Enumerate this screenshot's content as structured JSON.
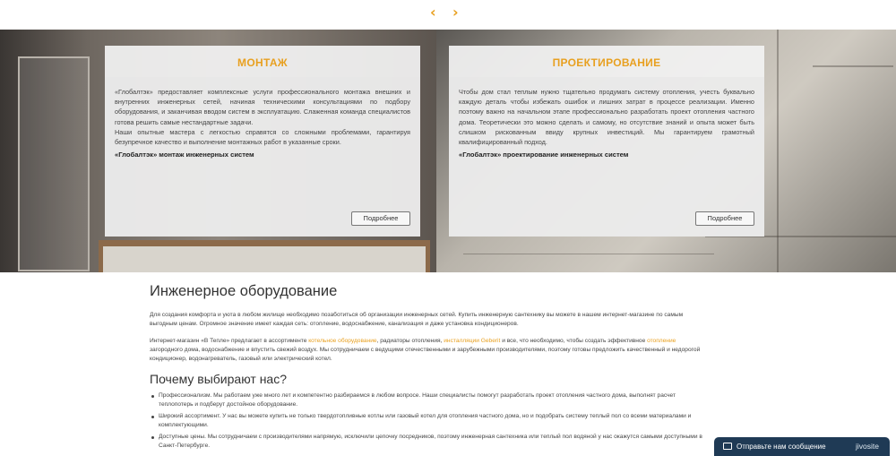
{
  "carousel": {
    "prev_icon": "‹",
    "next_icon": "›"
  },
  "cards": [
    {
      "title": "МОНТАЖ",
      "paragraphs": [
        "«Глобалтэк» предоставляет комплексные услуги профессионального монтажа внешних и внутренних инженерных сетей, начиная техническими консультациями по подбору оборудования, и заканчивая вводом систем в эксплуатацию. Слаженная команда специалистов готова решить самые нестандартные задачи.",
        "Наши опытные мастера с легкостью справятся со сложными проблемами, гарантируя безупречное качество и выполнение монтажных работ в указанные сроки."
      ],
      "bold": "«Глобалтэк» монтаж инженерных систем",
      "button": "Подробнее"
    },
    {
      "title": "ПРОЕКТИРОВАНИЕ",
      "paragraphs": [
        "Чтобы дом стал теплым нужно тщательно продумать систему отопления, учесть буквально каждую деталь чтобы избежать ошибок и лишних затрат в процессе реализации. Именно поэтому важно на начальном этапе профессионально разработать проект отопления частного дома. Теоретически это можно сделать и самому, но отсутствие знаний и опыта может быть слишком рискованным ввиду крупных инвестиций. Мы гарантируем грамотный квалифицированный подход."
      ],
      "bold": "«Глобалтэк» проектирование инженерных систем",
      "button": "Подробнее"
    }
  ],
  "article": {
    "title": "Инженерное оборудование",
    "intro": "Для создания комфорта и уюта в любом жилище необходимо позаботиться об организации инженерных сетей. Купить инженерную сантехнику вы можете в нашем интернет-магазине по самым выгодным ценам. Огромное значение имеет каждая сеть: отопление, водоснабжение, канализация и даже установка кондиционеров.",
    "shop": {
      "t1": "Интернет-магазин «В Тепле» предлагает в ассортименте ",
      "link1": "котельное оборудование",
      "t2": ", радиаторы отопления, ",
      "link2": "инсталляции Geberit",
      "t3": " и все, что необходимо, чтобы создать эффективное ",
      "link3": "отопление",
      "t4": " загородного дома, водоснабжение и впустить свежий воздух. Мы сотрудничаем с ведущими отечественными и зарубежными производителями, поэтому готовы предложить качественный и недорогой кондиционер, водонагреватель, газовый или электрический котел."
    },
    "why_title": "Почему выбирают нас?",
    "benefits": [
      "Профессионализм. Мы работаем уже много лет и компетентно разбираемся в любом вопросе. Наши специалисты помогут разработать проект отопления частного дома, выполнят расчет теплопотерь и подберут достойное оборудование.",
      "Широкий ассортимент. У нас вы можете купить не только твердотопливные котлы или газовый котел для отопления частного дома, но и подобрать систему теплый пол со всеми материалами и комплектующими.",
      "Доступные цены. Мы сотрудничаем с производителями напрямую, исключили цепочку посредников, поэтому инженерная сантехника или теплый пол водяной у нас окажутся самыми доступными в Санкт-Петербурге."
    ]
  },
  "chat": {
    "label": "Отправьте нам сообщение",
    "brand": "jivosite"
  },
  "colors": {
    "accent": "#e8a020",
    "chat_bg": "#1f3a55"
  }
}
